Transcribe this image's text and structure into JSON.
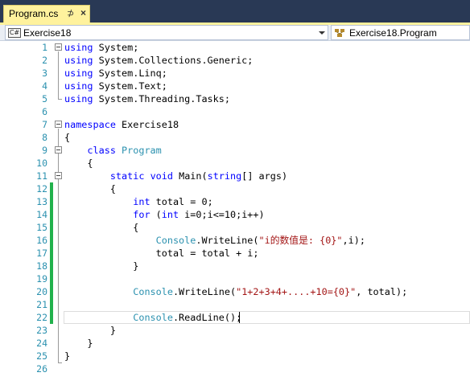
{
  "tab": {
    "title": "Program.cs",
    "pin_glyph": "⊅",
    "close_glyph": "×"
  },
  "navbar": {
    "left_icon_text": "C#",
    "left_combo": "Exercise18",
    "right_combo": "Exercise18.Program"
  },
  "editor": {
    "lines": [
      {
        "n": "1",
        "tokens": [
          {
            "t": "using",
            "c": "kw"
          },
          {
            "t": " System;",
            "c": ""
          }
        ]
      },
      {
        "n": "2",
        "tokens": [
          {
            "t": "using",
            "c": "kw"
          },
          {
            "t": " System.Collections.Generic;",
            "c": ""
          }
        ]
      },
      {
        "n": "3",
        "tokens": [
          {
            "t": "using",
            "c": "kw"
          },
          {
            "t": " System.Linq;",
            "c": ""
          }
        ]
      },
      {
        "n": "4",
        "tokens": [
          {
            "t": "using",
            "c": "kw"
          },
          {
            "t": " System.Text;",
            "c": ""
          }
        ]
      },
      {
        "n": "5",
        "tokens": [
          {
            "t": "using",
            "c": "kw"
          },
          {
            "t": " System.Threading.Tasks;",
            "c": ""
          }
        ]
      },
      {
        "n": "6",
        "tokens": []
      },
      {
        "n": "7",
        "tokens": [
          {
            "t": "namespace",
            "c": "kw"
          },
          {
            "t": " Exercise18",
            "c": ""
          }
        ]
      },
      {
        "n": "8",
        "tokens": [
          {
            "t": "{",
            "c": ""
          }
        ]
      },
      {
        "n": "9",
        "tokens": [
          {
            "t": "    ",
            "c": ""
          },
          {
            "t": "class",
            "c": "kw"
          },
          {
            "t": " ",
            "c": ""
          },
          {
            "t": "Program",
            "c": "typ"
          }
        ]
      },
      {
        "n": "10",
        "tokens": [
          {
            "t": "    {",
            "c": ""
          }
        ]
      },
      {
        "n": "11",
        "tokens": [
          {
            "t": "        ",
            "c": ""
          },
          {
            "t": "static",
            "c": "kw"
          },
          {
            "t": " ",
            "c": ""
          },
          {
            "t": "void",
            "c": "kw"
          },
          {
            "t": " Main(",
            "c": ""
          },
          {
            "t": "string",
            "c": "kw"
          },
          {
            "t": "[] args)",
            "c": ""
          }
        ]
      },
      {
        "n": "12",
        "tokens": [
          {
            "t": "        {",
            "c": ""
          }
        ]
      },
      {
        "n": "13",
        "tokens": [
          {
            "t": "            ",
            "c": ""
          },
          {
            "t": "int",
            "c": "kw"
          },
          {
            "t": " total = 0;",
            "c": ""
          }
        ]
      },
      {
        "n": "14",
        "tokens": [
          {
            "t": "            ",
            "c": ""
          },
          {
            "t": "for",
            "c": "kw"
          },
          {
            "t": " (",
            "c": ""
          },
          {
            "t": "int",
            "c": "kw"
          },
          {
            "t": " i=0;i<=10;i++)",
            "c": ""
          }
        ]
      },
      {
        "n": "15",
        "tokens": [
          {
            "t": "            {",
            "c": ""
          }
        ]
      },
      {
        "n": "16",
        "tokens": [
          {
            "t": "                ",
            "c": ""
          },
          {
            "t": "Console",
            "c": "typ"
          },
          {
            "t": ".WriteLine(",
            "c": ""
          },
          {
            "t": "\"i的数值是: {0}\"",
            "c": "str"
          },
          {
            "t": ",i);",
            "c": ""
          }
        ]
      },
      {
        "n": "17",
        "tokens": [
          {
            "t": "                total = total + i;",
            "c": ""
          }
        ]
      },
      {
        "n": "18",
        "tokens": [
          {
            "t": "            }",
            "c": ""
          }
        ]
      },
      {
        "n": "19",
        "tokens": []
      },
      {
        "n": "20",
        "tokens": [
          {
            "t": "            ",
            "c": ""
          },
          {
            "t": "Console",
            "c": "typ"
          },
          {
            "t": ".WriteLine(",
            "c": ""
          },
          {
            "t": "\"1+2+3+4+....+10={0}\"",
            "c": "str"
          },
          {
            "t": ", total);",
            "c": ""
          }
        ]
      },
      {
        "n": "21",
        "tokens": []
      },
      {
        "n": "22",
        "tokens": [
          {
            "t": "            ",
            "c": ""
          },
          {
            "t": "Console",
            "c": "typ"
          },
          {
            "t": ".ReadLine();",
            "c": ""
          }
        ]
      },
      {
        "n": "23",
        "tokens": [
          {
            "t": "        }",
            "c": ""
          }
        ]
      },
      {
        "n": "24",
        "tokens": [
          {
            "t": "    }",
            "c": ""
          }
        ]
      },
      {
        "n": "25",
        "tokens": [
          {
            "t": "}",
            "c": ""
          }
        ]
      },
      {
        "n": "26",
        "tokens": []
      }
    ]
  }
}
